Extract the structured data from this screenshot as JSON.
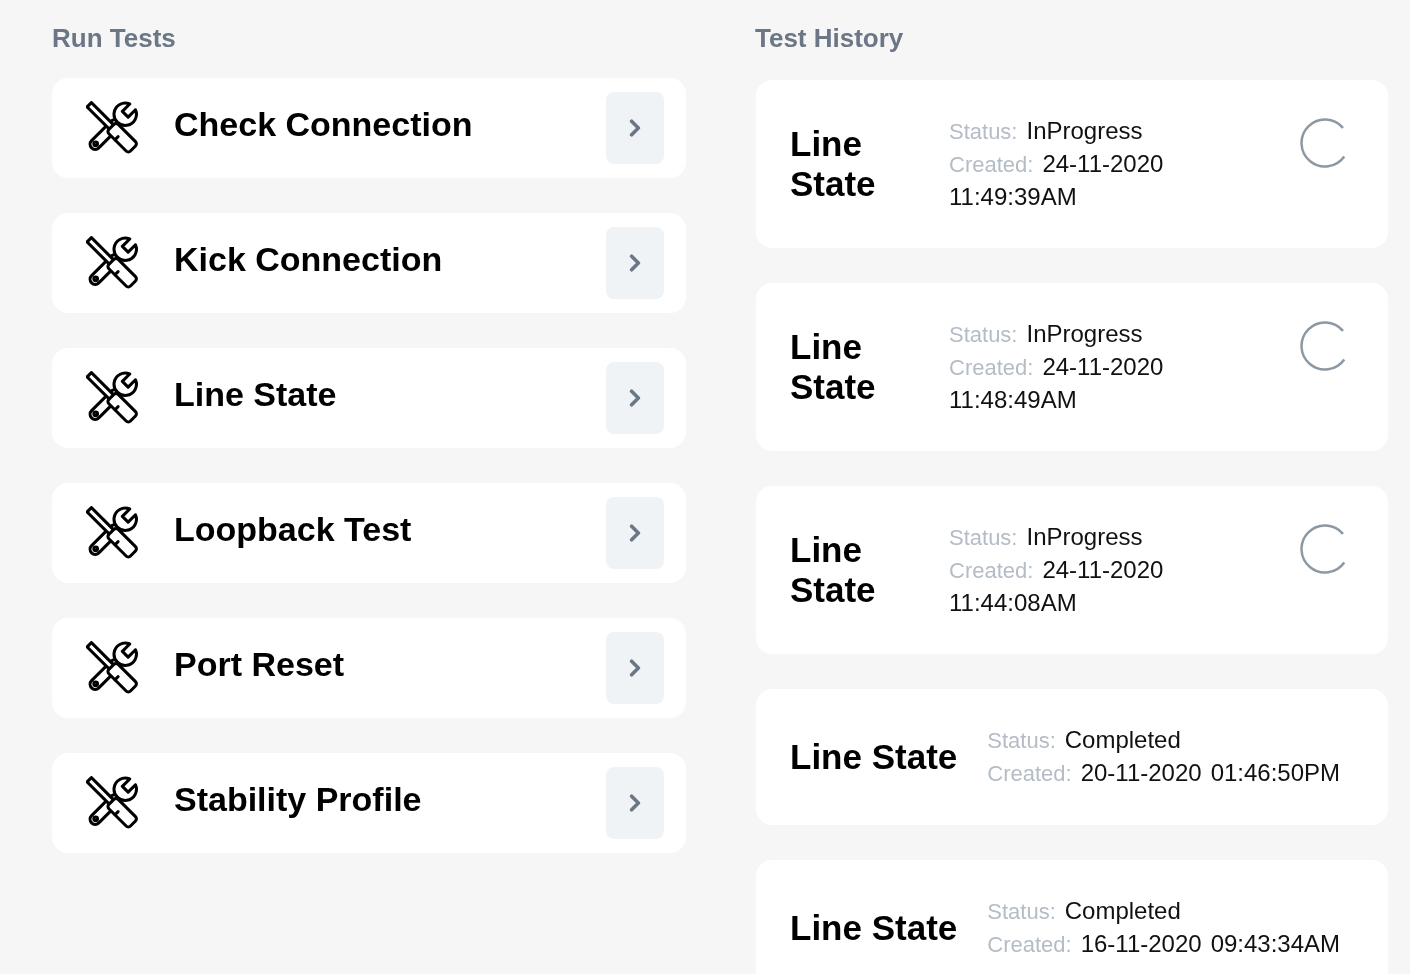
{
  "run_tests": {
    "title": "Run Tests",
    "items": [
      {
        "label": "Check Connection"
      },
      {
        "label": "Kick Connection"
      },
      {
        "label": "Line State"
      },
      {
        "label": "Loopback Test"
      },
      {
        "label": "Port Reset"
      },
      {
        "label": "Stability Profile"
      }
    ]
  },
  "test_history": {
    "title": "Test History",
    "items": [
      {
        "name": "Line State",
        "status_label": "Status:",
        "status": "InProgress",
        "created_label": "Created:",
        "created_date": "24-11-2020",
        "created_time": "11:49:39AM",
        "loading": true
      },
      {
        "name": "Line State",
        "status_label": "Status:",
        "status": "InProgress",
        "created_label": "Created:",
        "created_date": "24-11-2020",
        "created_time": "11:48:49AM",
        "loading": true
      },
      {
        "name": "Line State",
        "status_label": "Status:",
        "status": "InProgress",
        "created_label": "Created:",
        "created_date": "24-11-2020",
        "created_time": "11:44:08AM",
        "loading": true
      },
      {
        "name": "Line State",
        "status_label": "Status:",
        "status": "Completed",
        "created_label": "Created:",
        "created_date": "20-11-2020",
        "created_time": "01:46:50PM",
        "loading": false
      },
      {
        "name": "Line State",
        "status_label": "Status:",
        "status": "Completed",
        "created_label": "Created:",
        "created_date": "16-11-2020",
        "created_time": "09:43:34AM",
        "loading": false
      }
    ]
  }
}
